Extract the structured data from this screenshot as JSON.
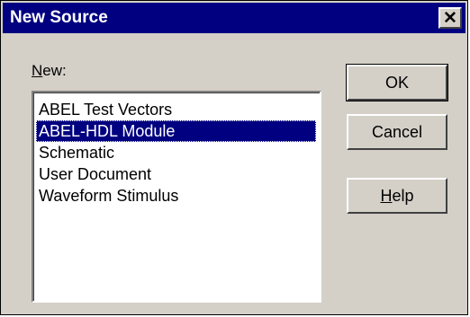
{
  "dialog": {
    "title": "New Source",
    "close_glyph": "✕"
  },
  "new_label": {
    "mnemonic": "N",
    "rest": "ew:"
  },
  "list": {
    "items": [
      {
        "label": "ABEL Test Vectors",
        "selected": false
      },
      {
        "label": "ABEL-HDL Module",
        "selected": true
      },
      {
        "label": "Schematic",
        "selected": false
      },
      {
        "label": "User Document",
        "selected": false
      },
      {
        "label": "Waveform Stimulus",
        "selected": false
      }
    ]
  },
  "buttons": {
    "ok": "OK",
    "cancel": "Cancel",
    "help_mnemonic": "H",
    "help_rest": "elp"
  },
  "colors": {
    "titlebar": "#000080",
    "dialog_face": "#d4d0c8",
    "selection": "#000080"
  }
}
